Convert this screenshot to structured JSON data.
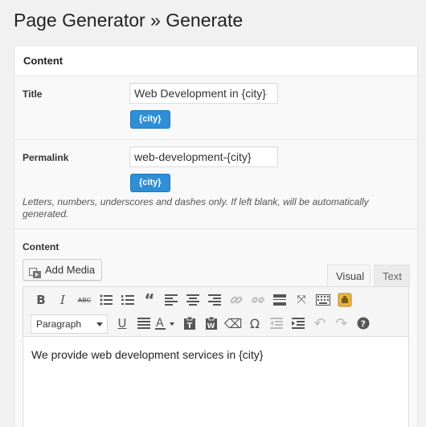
{
  "page": {
    "title": "Page Generator » Generate"
  },
  "panel": {
    "header": "Content"
  },
  "title_field": {
    "label": "Title",
    "value": "Web Development in {city}",
    "tag_label": "{city}"
  },
  "permalink_field": {
    "label": "Permalink",
    "value": "web-development-{city}",
    "tag_label": "{city}",
    "help": "Letters, numbers, underscores and dashes only. If left blank, will be automatically generated."
  },
  "content_field": {
    "label": "Content",
    "add_media_label": "Add Media",
    "tabs": {
      "visual": "Visual",
      "text": "Text"
    },
    "format_select": "Paragraph",
    "body": "We provide web development services in {city}"
  },
  "toolbar_icons": {
    "row1": [
      "bold-icon",
      "italic-icon",
      "strikethrough-icon",
      "bulleted-list-icon",
      "numbered-list-icon",
      "blockquote-icon",
      "align-left-icon",
      "align-center-icon",
      "align-right-icon",
      "link-icon",
      "unlink-icon",
      "read-more-icon",
      "fullscreen-icon",
      "toolbar-toggle-icon",
      "plugin-icon"
    ],
    "row2": [
      "format-select",
      "underline-icon",
      "justify-icon",
      "text-color-icon",
      "paste-text-icon",
      "paste-word-icon",
      "clear-formatting-icon",
      "special-character-icon",
      "outdent-icon",
      "indent-icon",
      "undo-icon",
      "redo-icon",
      "help-icon"
    ]
  },
  "colors": {
    "accent": "#2e8fd6",
    "background": "#f1f1f1"
  }
}
